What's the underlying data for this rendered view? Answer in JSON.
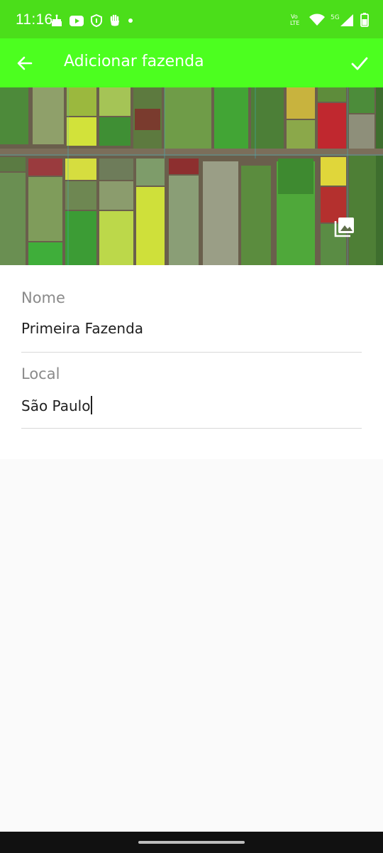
{
  "status_bar": {
    "time": "11:16",
    "left_icons": [
      "cake-icon",
      "youtube-icon",
      "shield-icon",
      "hand-icon",
      "dot-icon"
    ],
    "right_icons": [
      "volte-icon",
      "wifi-icon",
      "5g-signal-icon",
      "battery-icon"
    ],
    "volte_label": "Vo LTE",
    "network_label": "5G",
    "color": "#4bde1a"
  },
  "app_bar": {
    "title": "Adicionar fazenda",
    "back_icon": "arrow-back-icon",
    "confirm_icon": "check-icon",
    "color": "#4cff1f"
  },
  "header_image": {
    "description_icon": "gallery-icon"
  },
  "form": {
    "fields": [
      {
        "label": "Nome",
        "value": "Primeira Fazenda"
      },
      {
        "label": "Local",
        "value": "São Paulo"
      }
    ]
  },
  "colors": {
    "accent": "#4cff1f",
    "background": "#fafafa",
    "label": "#8a8a8a",
    "text": "#202020"
  }
}
